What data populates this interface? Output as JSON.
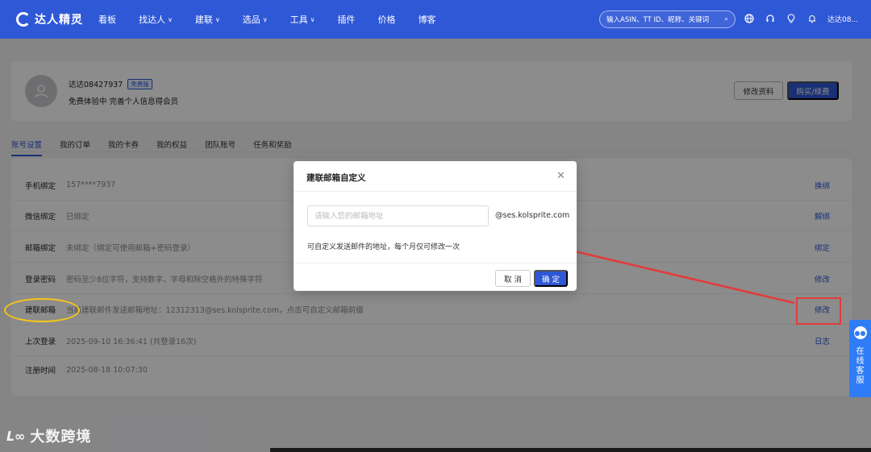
{
  "nav": {
    "logo_text": "达人精灵",
    "items": [
      {
        "label": "看板",
        "has_caret": false
      },
      {
        "label": "找达人",
        "has_caret": true
      },
      {
        "label": "建联",
        "has_caret": true
      },
      {
        "label": "选品",
        "has_caret": true
      },
      {
        "label": "工具",
        "has_caret": true
      },
      {
        "label": "插件",
        "has_caret": false
      },
      {
        "label": "价格",
        "has_caret": false
      },
      {
        "label": "博客",
        "has_caret": false
      }
    ],
    "search_placeholder": "输入ASIN、TT ID、昵称、关键词",
    "user": "达达08..."
  },
  "profile": {
    "name": "达达08427937",
    "badge": "免费版",
    "subtitle": "免费体验中 完善个人信息得会员",
    "edit_label": "修改资料",
    "buy_label": "购买/续费"
  },
  "tabs": [
    {
      "label": "账号设置",
      "active": true
    },
    {
      "label": "我的订单",
      "active": false
    },
    {
      "label": "我的卡券",
      "active": false
    },
    {
      "label": "我的权益",
      "active": false
    },
    {
      "label": "团队账号",
      "active": false
    },
    {
      "label": "任务和奖励",
      "active": false
    }
  ],
  "settings": [
    {
      "label": "手机绑定",
      "value": "157****7937",
      "action": "换绑"
    },
    {
      "label": "微信绑定",
      "value": "已绑定",
      "action": "解绑"
    },
    {
      "label": "邮箱绑定",
      "value": "未绑定（绑定可使用邮箱+密码登录）",
      "action": "绑定"
    },
    {
      "label": "登录密码",
      "value": "密码至少8位字符，支持数字、字母和除空格外的特殊字符",
      "action": "修改"
    },
    {
      "label": "建联邮箱",
      "value": "当前建联邮件发送邮箱地址：12312313@ses.kolsprite.com，点击可自定义邮箱前缀",
      "action": "修改"
    },
    {
      "label": "上次登录",
      "value": "2025-09-10 16:36:41 (共登录16次)",
      "action": "日志"
    },
    {
      "label": "注册时间",
      "value": "2025-08-18 10:07:30",
      "action": ""
    }
  ],
  "modal": {
    "title": "建联邮箱自定义",
    "input_placeholder": "请输入您的邮箱地址",
    "input_value": "",
    "suffix": "@ses.kolsprite.com",
    "hint": "可自定义发送邮件的地址，每个月仅可修改一次",
    "cancel_label": "取 消",
    "ok_label": "确 定"
  },
  "service": {
    "label": "在线客服"
  },
  "watermark": {
    "text": "大数跨境"
  },
  "colors": {
    "brand": "#2f58d6",
    "highlight_box": "#e23b3b",
    "highlight_ellipse": "#f5c518"
  }
}
